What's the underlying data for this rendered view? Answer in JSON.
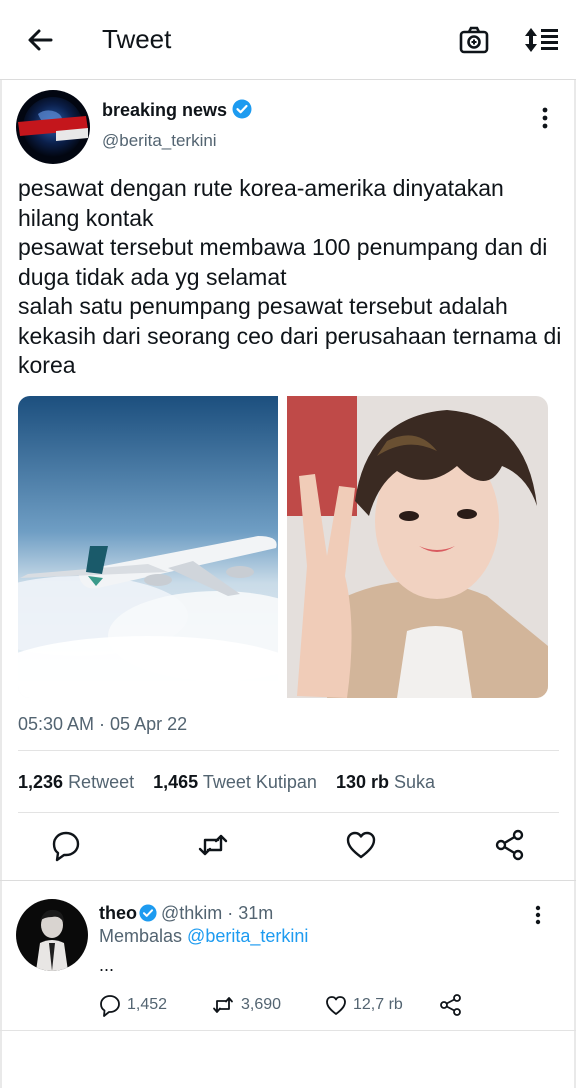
{
  "header": {
    "title": "Tweet",
    "back_icon": "arrow-left-icon",
    "camera_icon": "camera-icon",
    "sort_icon": "sort-icon"
  },
  "tweet": {
    "author_name": "breaking news",
    "author_handle": "@berita_terkini",
    "avatar_text": "BREAKING NEWS",
    "verified": true,
    "text": "pesawat dengan rute korea-amerika dinyatakan hilang kontak\npesawat tersebut membawa 100 penumpang dan di duga tidak ada yg selamat\nsalah satu penumpang pesawat tersebut adalah kekasih dari seorang ceo dari perusahaan ternama di korea",
    "timestamp": "05:30 AM · 05 Apr 22",
    "stats": {
      "retweets": "1,236",
      "retweets_label": "Retweet",
      "quotes": "1,465",
      "quotes_label": "Tweet Kutipan",
      "likes": "130 rb",
      "likes_label": "Suka"
    },
    "actions": [
      "reply-icon",
      "retweet-icon",
      "like-icon",
      "share-icon"
    ]
  },
  "reply": {
    "name": "theo",
    "handle": "@thkim",
    "sep": " · ",
    "time": "31m",
    "replying_label": "Membalas",
    "replying_to": "@berita_terkini",
    "body": "...",
    "replies": "1,452",
    "retweets": "3,690",
    "likes": "12,7 rb"
  },
  "colors": {
    "text": "#0f1419",
    "secondary": "#536471",
    "accent": "#1d9bf0",
    "divider": "#e3e3e3"
  }
}
